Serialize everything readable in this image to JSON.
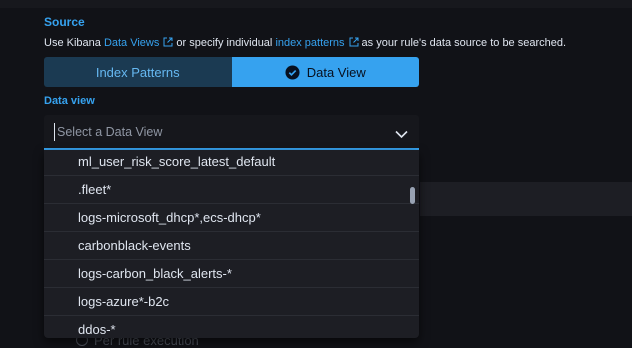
{
  "source": {
    "label": "Source",
    "help": {
      "prefix": "Use Kibana",
      "link1": "Data Views",
      "middle": "or specify individual",
      "link2": "index patterns",
      "suffix": "as your rule's data source to be searched."
    },
    "toggle": {
      "index_patterns": "Index Patterns",
      "data_view": "Data View",
      "selected": "Data View"
    }
  },
  "data_view_field": {
    "label": "Data view",
    "placeholder": "Select a Data View",
    "value": ""
  },
  "dropdown": {
    "options": [
      "ml_user_risk_score_latest_default",
      ".fleet*",
      "logs-microsoft_dhcp*,ecs-dhcp*",
      "carbonblack-events",
      "logs-carbon_black_alerts-*",
      "logs-azure*-b2c",
      "ddos-*"
    ]
  },
  "background": {
    "radio_label": "Per rule execution"
  },
  "colors": {
    "accent": "#36a2ef",
    "background": "#111217",
    "panel": "#1d1e24"
  }
}
